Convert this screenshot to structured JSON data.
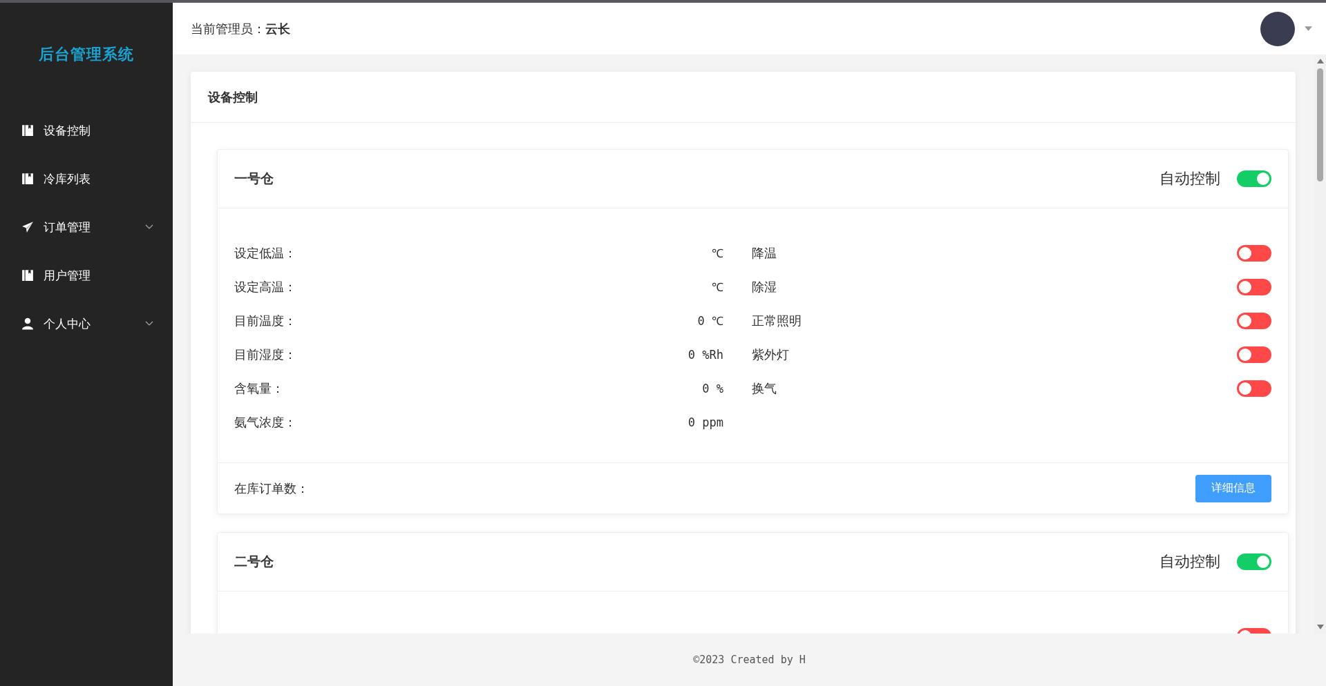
{
  "sidebar": {
    "title": "后台管理系统",
    "items": [
      {
        "label": "设备控制",
        "kind": "book",
        "has_submenu": false
      },
      {
        "label": "冷库列表",
        "kind": "book",
        "has_submenu": false
      },
      {
        "label": "订单管理",
        "kind": "plane",
        "has_submenu": true
      },
      {
        "label": "用户管理",
        "kind": "book",
        "has_submenu": false
      },
      {
        "label": "个人中心",
        "kind": "user",
        "has_submenu": true
      }
    ]
  },
  "header": {
    "admin_label": "当前管理员：",
    "admin_name": "云长"
  },
  "panel": {
    "title": "设备控制"
  },
  "warehouses": [
    {
      "name": "一号仓",
      "auto_label": "自动控制",
      "auto_on": true,
      "readings": [
        {
          "label": "设定低温：",
          "value": "℃"
        },
        {
          "label": "设定高温：",
          "value": "℃"
        },
        {
          "label": "目前温度：",
          "value": "0 ℃"
        },
        {
          "label": "目前湿度：",
          "value": "0 %Rh"
        },
        {
          "label": "含氧量：",
          "value": "0 %"
        },
        {
          "label": "氨气浓度：",
          "value": "0 ppm"
        }
      ],
      "controls": [
        {
          "label": "降温",
          "on": false
        },
        {
          "label": "除湿",
          "on": false
        },
        {
          "label": "正常照明",
          "on": false
        },
        {
          "label": "紫外灯",
          "on": false
        },
        {
          "label": "换气",
          "on": false
        }
      ],
      "orders_label": "在库订单数：",
      "details_button": "详细信息"
    },
    {
      "name": "二号仓",
      "auto_label": "自动控制",
      "auto_on": true,
      "controls": [
        {
          "on": false
        }
      ]
    }
  ],
  "footer": "©2023 Created by H"
}
